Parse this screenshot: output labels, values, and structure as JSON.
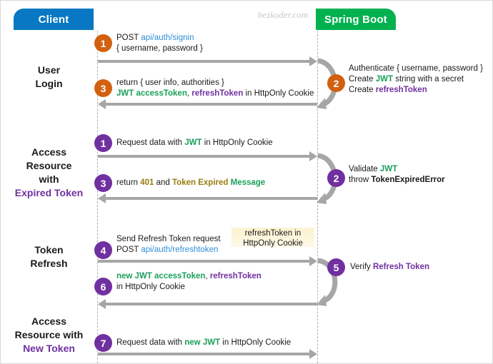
{
  "watermark": "bezkoder.com",
  "actors": {
    "client": {
      "label": "Client",
      "color": "#0878c4"
    },
    "server": {
      "label": "Spring Boot",
      "color": "#00b14f"
    }
  },
  "colors": {
    "client_blue": "#0878c4",
    "server_green": "#00b14f",
    "badge_orange": "#d2600f",
    "badge_purple": "#7030a0",
    "arrow_gray": "#a6a6a6",
    "jwt_green": "#19a05a",
    "refresh_purple": "#7030a0",
    "link_blue": "#2f8fd8",
    "warn_gold": "#9a7d10",
    "callout_yellow": "#fdf3d2"
  },
  "phases": [
    {
      "name": "user-login",
      "lines": [
        {
          "text": "User",
          "accent": false
        },
        {
          "text": "Login",
          "accent": false
        }
      ]
    },
    {
      "name": "expired-token",
      "lines": [
        {
          "text": "Access",
          "accent": false
        },
        {
          "text": "Resource",
          "accent": false
        },
        {
          "text": "with",
          "accent": false
        },
        {
          "text": "Expired Token",
          "accent": true
        }
      ]
    },
    {
      "name": "token-refresh",
      "lines": [
        {
          "text": "Token",
          "accent": false
        },
        {
          "text": "Refresh",
          "accent": false
        }
      ]
    },
    {
      "name": "new-token",
      "lines": [
        {
          "text": "Access",
          "accent": false
        },
        {
          "text": "Resource with",
          "accent": false
        },
        {
          "text": "New Token",
          "accent": true
        }
      ]
    }
  ],
  "steps": {
    "s1": {
      "number": "1",
      "color": "orange"
    },
    "s2": {
      "number": "2",
      "color": "orange"
    },
    "s3": {
      "number": "3",
      "color": "orange"
    },
    "s4": {
      "number": "1",
      "color": "purple"
    },
    "s5": {
      "number": "2",
      "color": "purple"
    },
    "s6": {
      "number": "3",
      "color": "purple"
    },
    "s7": {
      "number": "4",
      "color": "purple"
    },
    "s8": {
      "number": "5",
      "color": "purple"
    },
    "s9": {
      "number": "6",
      "color": "purple"
    },
    "s10": {
      "number": "7",
      "color": "purple"
    }
  },
  "messages": {
    "m1_l1_a": "POST ",
    "m1_l1_b": "api/auth/signin",
    "m1_l2": "{ username, password }",
    "m2_l1": "Authenticate { username, password }",
    "m2_l2_a": "Create ",
    "m2_l2_b": "JWT",
    "m2_l2_c": " string with a secret",
    "m2_l3_a": "Create ",
    "m2_l3_b": "refreshToken",
    "m3_l1": "return { user info, authorities }",
    "m3_l2_a": "JWT accessToken",
    "m3_l2_b": ", ",
    "m3_l2_c": "refreshToken",
    "m3_l2_d": " in HttpOnly Cookie",
    "m4_a": "Request data with ",
    "m4_b": "JWT",
    "m4_c": " in HttpOnly Cookie",
    "m5_l1_a": "Validate ",
    "m5_l1_b": "JWT",
    "m5_l2_a": "throw ",
    "m5_l2_b": "TokenExpiredError",
    "m6_a": "return ",
    "m6_b": "401",
    "m6_c": " and ",
    "m6_d": "Token Expired ",
    "m6_e": "Message",
    "m7_l1": "Send Refresh Token request",
    "m7_l2_a": "POST ",
    "m7_l2_b": "api/auth/refreshtoken",
    "callout_l1_a": "refreshToken",
    "callout_l1_b": " in",
    "callout_l2": "HttpOnly Cookie",
    "m8_a": "Verify ",
    "m8_b": "Refresh Token",
    "m9_l1_a": "new JWT accessToken",
    "m9_l1_b": ", ",
    "m9_l1_c": "refreshToken",
    "m9_l2": "in HttpOnly Cookie",
    "m10_a": "Request data with ",
    "m10_b": "new JWT",
    "m10_c": " in HttpOnly Cookie"
  }
}
